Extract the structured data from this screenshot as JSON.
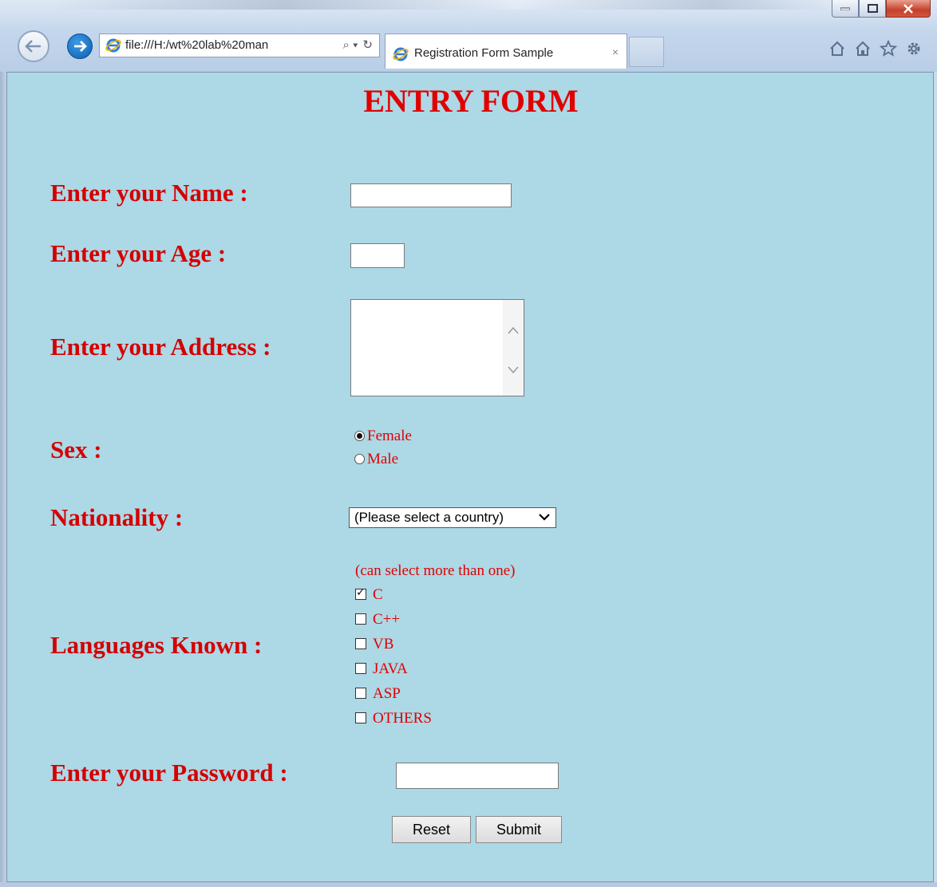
{
  "browser": {
    "address": "file:///H:/wt%20lab%20man",
    "tab_title": "Registration Form Sample",
    "tab_close": "×",
    "search_glyph": "⌕ ▾",
    "refresh_glyph": "↻"
  },
  "form": {
    "title": "ENTRY FORM",
    "name_label": "Enter your Name :",
    "name_value": "",
    "age_label": "Enter your Age :",
    "age_value": "",
    "address_label": "Enter your Address :",
    "address_value": "",
    "sex_label": "Sex :",
    "sex_options": [
      "Female",
      "Male"
    ],
    "sex_selected": "Female",
    "nationality_label": "Nationality :",
    "nationality_selected": "(Please select a country)",
    "languages_label": "Languages Known :",
    "languages_hint": "(can select more than one)",
    "languages": [
      {
        "label": "C",
        "checked": true
      },
      {
        "label": "C++",
        "checked": false
      },
      {
        "label": "VB",
        "checked": false
      },
      {
        "label": "JAVA",
        "checked": false
      },
      {
        "label": "ASP",
        "checked": false
      },
      {
        "label": "OTHERS",
        "checked": false
      }
    ],
    "password_label": "Enter your Password :",
    "password_value": "",
    "reset_label": "Reset",
    "submit_label": "Submit"
  },
  "colors": {
    "page_background": "#add8e6",
    "label_color": "#d40000"
  }
}
